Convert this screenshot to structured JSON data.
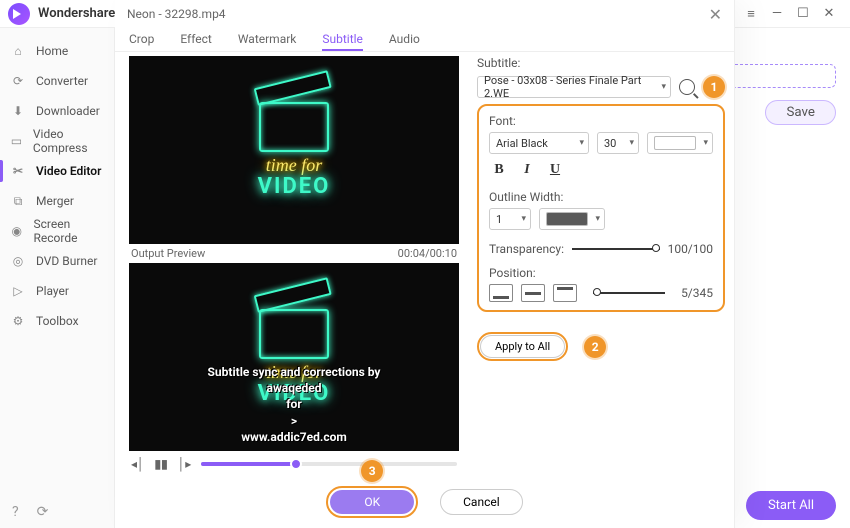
{
  "app": {
    "name": "Wondershare"
  },
  "win": {
    "menu": "≡",
    "min": "—",
    "max": "☐",
    "close": "✕"
  },
  "sidebar": {
    "items": [
      {
        "label": "Home"
      },
      {
        "label": "Converter"
      },
      {
        "label": "Downloader"
      },
      {
        "label": "Video Compress"
      },
      {
        "label": "Video Editor"
      },
      {
        "label": "Merger"
      },
      {
        "label": "Screen Recorde"
      },
      {
        "label": "DVD Burner"
      },
      {
        "label": "Player"
      },
      {
        "label": "Toolbox"
      }
    ]
  },
  "main": {
    "save": "Save",
    "start_all": "Start All"
  },
  "modal": {
    "title": "Neon - 32298.mp4",
    "tabs": [
      "Crop",
      "Effect",
      "Watermark",
      "Subtitle",
      "Audio"
    ],
    "preview_label": "Output Preview",
    "time": "00:04/00:10",
    "neon1": "time for",
    "neon2": "VIDEO",
    "subs": {
      "l1": "Subtitle sync and corrections by",
      "l2": "awaqeded",
      "l3": "for",
      "l4": ">",
      "l5": "www.addic7ed.com"
    },
    "panel": {
      "subtitle_label": "Subtitle:",
      "subtitle_file": "Pose - 03x08 - Series Finale Part 2.WE",
      "font_label": "Font:",
      "font_name": "Arial Black",
      "font_size": "30",
      "outline_label": "Outline Width:",
      "outline_w": "1",
      "trans_label": "Transparency:",
      "trans_val": "100/100",
      "pos_label": "Position:",
      "pos_val": "5/345",
      "apply": "Apply to All",
      "ok": "OK",
      "cancel": "Cancel"
    },
    "ann": {
      "a1": "1",
      "a2": "2",
      "a3": "3"
    }
  }
}
